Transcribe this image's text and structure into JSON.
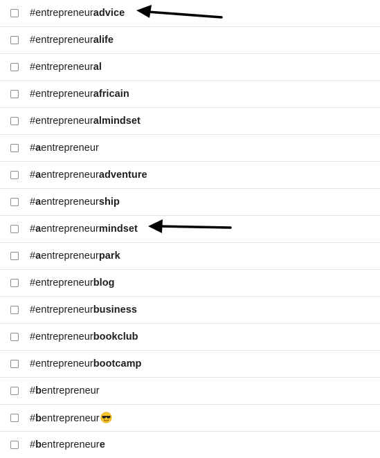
{
  "hashtags": [
    {
      "segments": [
        {
          "text": "#entrepreneur",
          "bold": false
        },
        {
          "text": "advice",
          "bold": true
        }
      ]
    },
    {
      "segments": [
        {
          "text": "#entrepreneur",
          "bold": false
        },
        {
          "text": "alife",
          "bold": true
        }
      ]
    },
    {
      "segments": [
        {
          "text": "#entrepreneur",
          "bold": false
        },
        {
          "text": "al",
          "bold": true
        }
      ]
    },
    {
      "segments": [
        {
          "text": "#entrepreneur",
          "bold": false
        },
        {
          "text": "africain",
          "bold": true
        }
      ]
    },
    {
      "segments": [
        {
          "text": "#entrepreneur",
          "bold": false
        },
        {
          "text": "almindset",
          "bold": true
        }
      ]
    },
    {
      "segments": [
        {
          "text": "#",
          "bold": false
        },
        {
          "text": "a",
          "bold": true
        },
        {
          "text": "entrepreneur",
          "bold": false
        }
      ]
    },
    {
      "segments": [
        {
          "text": "#",
          "bold": false
        },
        {
          "text": "a",
          "bold": true
        },
        {
          "text": "entrepreneur",
          "bold": false
        },
        {
          "text": "adventure",
          "bold": true
        }
      ]
    },
    {
      "segments": [
        {
          "text": "#",
          "bold": false
        },
        {
          "text": "a",
          "bold": true
        },
        {
          "text": "entrepreneur",
          "bold": false
        },
        {
          "text": "ship",
          "bold": true
        }
      ]
    },
    {
      "segments": [
        {
          "text": "#",
          "bold": false
        },
        {
          "text": "a",
          "bold": true
        },
        {
          "text": "entrepreneur",
          "bold": false
        },
        {
          "text": "mindset",
          "bold": true
        }
      ]
    },
    {
      "segments": [
        {
          "text": "#",
          "bold": false
        },
        {
          "text": "a",
          "bold": true
        },
        {
          "text": "entrepreneur",
          "bold": false
        },
        {
          "text": "park",
          "bold": true
        }
      ]
    },
    {
      "segments": [
        {
          "text": "#entrepreneur",
          "bold": false
        },
        {
          "text": "blog",
          "bold": true
        }
      ]
    },
    {
      "segments": [
        {
          "text": "#entrepreneur",
          "bold": false
        },
        {
          "text": "business",
          "bold": true
        }
      ]
    },
    {
      "segments": [
        {
          "text": "#entrepreneur",
          "bold": false
        },
        {
          "text": "bookclub",
          "bold": true
        }
      ]
    },
    {
      "segments": [
        {
          "text": "#entrepreneur",
          "bold": false
        },
        {
          "text": "bootcamp",
          "bold": true
        }
      ]
    },
    {
      "segments": [
        {
          "text": "#",
          "bold": false
        },
        {
          "text": "b",
          "bold": true
        },
        {
          "text": "entrepreneur",
          "bold": false
        }
      ]
    },
    {
      "segments": [
        {
          "text": "#",
          "bold": false
        },
        {
          "text": "b",
          "bold": true
        },
        {
          "text": "entrepreneur",
          "bold": false
        }
      ],
      "emoji": "sunglasses-emoji-icon"
    },
    {
      "segments": [
        {
          "text": "#",
          "bold": false
        },
        {
          "text": "b",
          "bold": true
        },
        {
          "text": "entrepreneur",
          "bold": false
        },
        {
          "text": "e",
          "bold": true
        }
      ]
    }
  ],
  "checkbox_checked": [
    false,
    false,
    false,
    false,
    false,
    false,
    false,
    false,
    false,
    false,
    false,
    false,
    false,
    false,
    false,
    false,
    false
  ],
  "arrows": [
    {
      "points_to": "#entrepreneuradvice",
      "icon": "left-arrow-icon"
    },
    {
      "points_to": "#aentrepreneurmindset",
      "icon": "left-arrow-icon"
    }
  ],
  "colors": {
    "text": "#1c1e21",
    "divider": "#e3e3e3",
    "checkbox_border": "#8c8c8c",
    "arrow": "#000000"
  }
}
